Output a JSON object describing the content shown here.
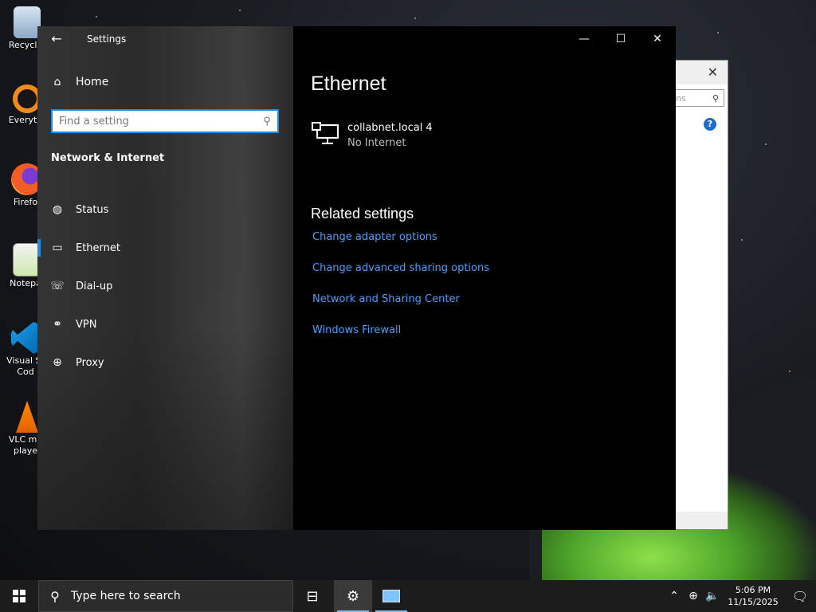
{
  "desktop": {
    "icons": [
      {
        "label": "Recycle",
        "icon": "recycle-bin-icon"
      },
      {
        "label": "Everyth",
        "icon": "everything-search-icon"
      },
      {
        "label": "Firefo",
        "icon": "firefox-icon"
      },
      {
        "label": "Notepa",
        "icon": "notepad-plus-icon"
      },
      {
        "label": "Visual St",
        "label2": "Cod",
        "icon": "vscode-icon"
      },
      {
        "label": "VLC me",
        "label2": "playe",
        "icon": "vlc-icon"
      }
    ]
  },
  "background_window": {
    "search_placeholder": "ns",
    "close": "✕",
    "help": "?"
  },
  "settings": {
    "app_title": "Settings",
    "back_icon": "arrow-left-icon",
    "controls": {
      "minimize": "—",
      "maximize": "☐",
      "close": "✕"
    },
    "nav": {
      "home_label": "Home",
      "search_placeholder": "Find a setting",
      "section_title": "Network & Internet",
      "items": [
        {
          "label": "Status",
          "icon": "globe-icon"
        },
        {
          "label": "Ethernet",
          "icon": "ethernet-icon",
          "active": true
        },
        {
          "label": "Dial-up",
          "icon": "dial-up-icon"
        },
        {
          "label": "VPN",
          "icon": "vpn-icon"
        },
        {
          "label": "Proxy",
          "icon": "proxy-globe-icon"
        }
      ]
    },
    "content": {
      "page_title": "Ethernet",
      "connection": {
        "name": "collabnet.local 4",
        "status": "No Internet"
      },
      "related_title": "Related settings",
      "related_links": [
        "Change adapter options",
        "Change advanced sharing options",
        "Network and Sharing Center",
        "Windows Firewall"
      ]
    }
  },
  "taskbar": {
    "search_placeholder": "Type here to search",
    "clock_time": "5:06 PM",
    "clock_date": "11/15/2025"
  },
  "colors": {
    "accent": "#1e8ce0",
    "link": "#4aa0ff",
    "content_bg": "#000000",
    "taskbar_bg": "#1c1c1c"
  }
}
